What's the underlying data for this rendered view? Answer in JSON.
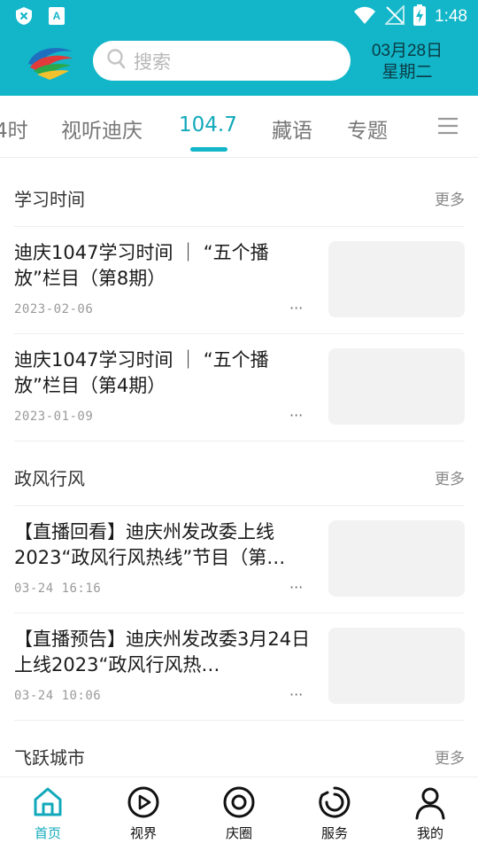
{
  "status_bar": {
    "time": "1:48",
    "icons": [
      "shield-x-icon",
      "app-a-icon",
      "wifi-icon",
      "no-signal-icon",
      "battery-charging-icon"
    ]
  },
  "header": {
    "logo": "dianqing-logo",
    "search_placeholder": "搜索",
    "date_line1": "03月28日",
    "date_line2": "星期二"
  },
  "tabs": {
    "items": [
      {
        "label": "4时",
        "active": false
      },
      {
        "label": "视听迪庆",
        "active": false
      },
      {
        "label": "104.7",
        "active": true
      },
      {
        "label": "藏语",
        "active": false
      },
      {
        "label": "专题",
        "active": false
      }
    ],
    "menu_icon": "hamburger-menu-icon"
  },
  "sections": [
    {
      "title": "学习时间",
      "more": "更多",
      "items": [
        {
          "title": "迪庆1047学习时间 ｜ “五个播放”栏目（第8期）",
          "date": "2023-02-06",
          "more": "···"
        },
        {
          "title": "迪庆1047学习时间 ｜ “五个播放”栏目（第4期）",
          "date": "2023-01-09",
          "more": "···"
        }
      ]
    },
    {
      "title": "政风行风",
      "more": "更多",
      "items": [
        {
          "title": "【直播回看】迪庆州发改委上线2023“政风行风热线”节目（第…",
          "date": "03-24 16:16",
          "more": "···"
        },
        {
          "title": "【直播预告】迪庆州发改委3月24日上线2023“政风行风热…",
          "date": "03-24 10:06",
          "more": "···"
        }
      ]
    },
    {
      "title": "飞跃城市",
      "more": "更多",
      "items": []
    }
  ],
  "bottom_nav": {
    "items": [
      {
        "label": "首页",
        "icon": "home-icon",
        "active": true
      },
      {
        "label": "视界",
        "icon": "play-circle-icon",
        "active": false
      },
      {
        "label": "庆圈",
        "icon": "circle-ring-icon",
        "active": false
      },
      {
        "label": "服务",
        "icon": "service-swirl-icon",
        "active": false
      },
      {
        "label": "我的",
        "icon": "person-icon",
        "active": false
      }
    ]
  },
  "colors": {
    "brand": "#12b6c8",
    "active_text": "#12a9bb",
    "thumb_placeholder": "#f2f2f2"
  }
}
